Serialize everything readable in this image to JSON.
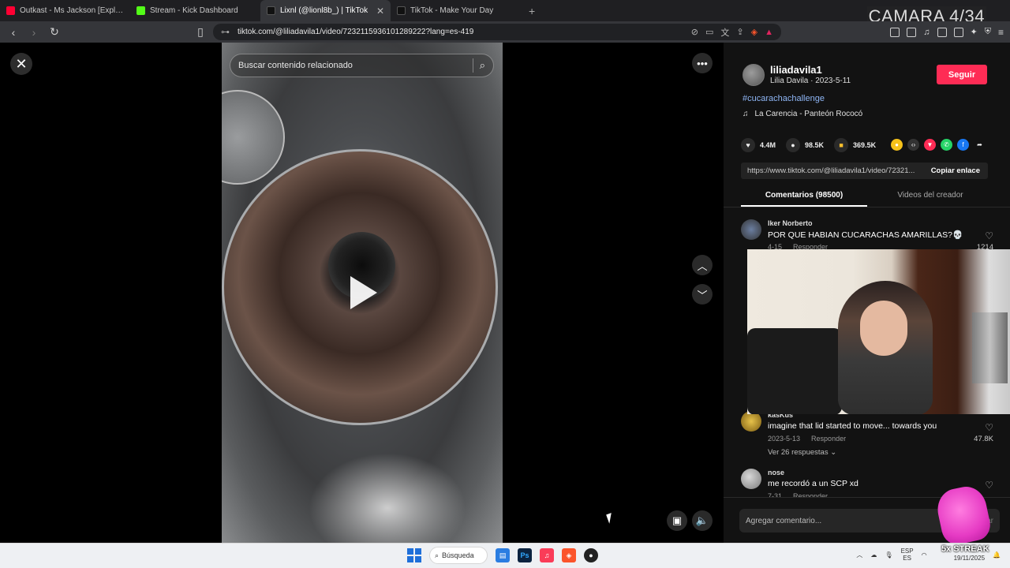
{
  "browser": {
    "tabs": [
      {
        "label": "Outkast - Ms Jackson [Explicit] - YouTube",
        "color": "#ff0033",
        "active": false
      },
      {
        "label": "Stream - Kick Dashboard",
        "color": "#53fc18",
        "active": false
      },
      {
        "label": "Lixnl (@lionl8b_) | TikTok",
        "color": "#000000",
        "active": true
      },
      {
        "label": "TikTok - Make Your Day",
        "color": "#000000",
        "active": false
      }
    ],
    "new_tab": "+",
    "url": "tiktok.com/@liliadavila1/video/7232115936101289222?lang=es-419",
    "camera_label": "CAMARA 4/34"
  },
  "video": {
    "search_placeholder": "Buscar contenido relacionado"
  },
  "creator": {
    "username": "liliadavila1",
    "subline": "Lilia Davila · 2023-5-11",
    "follow_label": "Seguir",
    "hashtag": "#cucarachachallenge",
    "music": "La Carencia - Panteón Rococó"
  },
  "stats": {
    "likes": "4.4M",
    "comments": "98.5K",
    "saves": "369.5K"
  },
  "share": {
    "link": "https://www.tiktok.com/@liliadavila1/video/72321...",
    "copy_label": "Copiar enlace"
  },
  "panel_tabs": {
    "comments": "Comentarios (98500)",
    "creator_videos": "Videos del creador"
  },
  "comments": [
    {
      "name": "Iker Norberto",
      "text": "POR QUE HABIAN CUCARACHAS AMARILLAS?💀",
      "date": "4-15",
      "reply": "Responder",
      "likes": "1214"
    },
    {
      "name": "kasKus",
      "text": "imagine that lid started to move... towards you",
      "date": "2023-5-13",
      "reply": "Responder",
      "likes": "47.8K"
    },
    {
      "name": "nose",
      "text": "me recordó a un SCP xd",
      "date": "7-31",
      "reply": "Responder",
      "likes": ""
    }
  ],
  "view_replies": "Ver 26 respuestas",
  "add_comment": {
    "placeholder": "Agregar comentario...",
    "at": "@",
    "post": "ar"
  },
  "taskbar": {
    "search_label": "Búsqueda",
    "lang_top": "ESP",
    "lang_bottom": "ES",
    "date": "19/11/2025",
    "streak": "5x STREAK"
  }
}
